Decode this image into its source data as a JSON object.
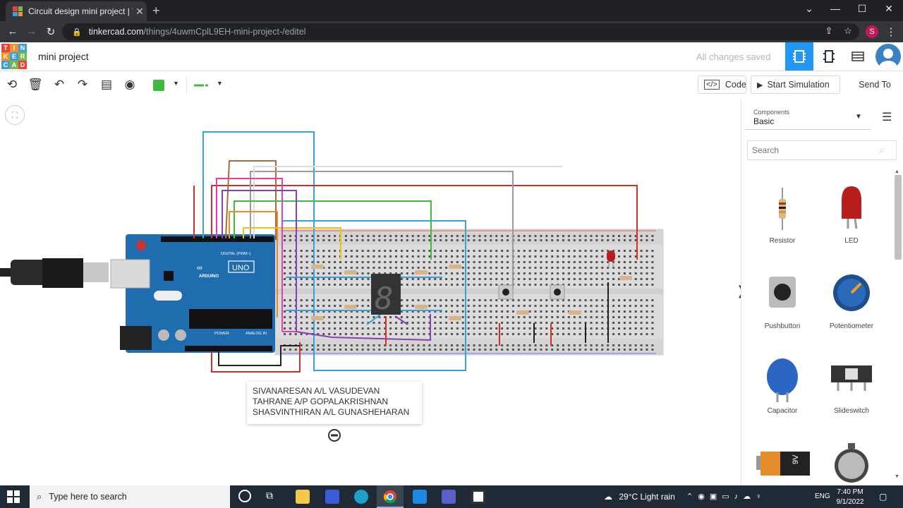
{
  "browser": {
    "tab_title": "Circuit design mini project | Tinke",
    "url_host": "tinkercad.com",
    "url_path": "/things/4uwmCplL9EH-mini-project-/editel",
    "profile_initial": "S"
  },
  "tinkercad": {
    "logo_letters": [
      "T",
      "I",
      "N",
      "K",
      "E",
      "R",
      "C",
      "A",
      "D"
    ],
    "logo_colors": [
      "#e8423d",
      "#f0932b",
      "#3e9fd6",
      "#f0932b",
      "#3e9fd6",
      "#7ab648",
      "#3e9fd6",
      "#7ab648",
      "#e8423d"
    ],
    "project_title": "mini project",
    "save_status": "All changes saved",
    "code_label": "Code",
    "start_sim_label": "Start Simulation",
    "send_to_label": "Send To",
    "active_color": "#2196f3"
  },
  "components_panel": {
    "label": "Components",
    "value": "Basic",
    "search_placeholder": "Search",
    "items": [
      "Resistor",
      "LED",
      "Pushbutton",
      "Potentiometer",
      "Capacitor",
      "Slideswitch"
    ]
  },
  "arduino": {
    "brand": "ARDUINO",
    "model": "UNO",
    "digital_label": "DIGITAL (PWM~)",
    "power_label": "POWER",
    "analog_label": "ANALOG IN",
    "color": "#1f6cae"
  },
  "seven_segment_digit": "8",
  "note_lines": [
    "SIVANARESAN A/L VASUDEVAN",
    "TAHRANE A/P GOPALAKRISHNAN",
    "SHASVINTHIRAN A/L GUNASHEHARAN"
  ],
  "battery_label": "9V",
  "taskbar": {
    "search_placeholder": "Type here to search",
    "weather": "29°C  Light rain",
    "language": "ENG",
    "time": "7:40 PM",
    "date": "9/1/2022"
  }
}
